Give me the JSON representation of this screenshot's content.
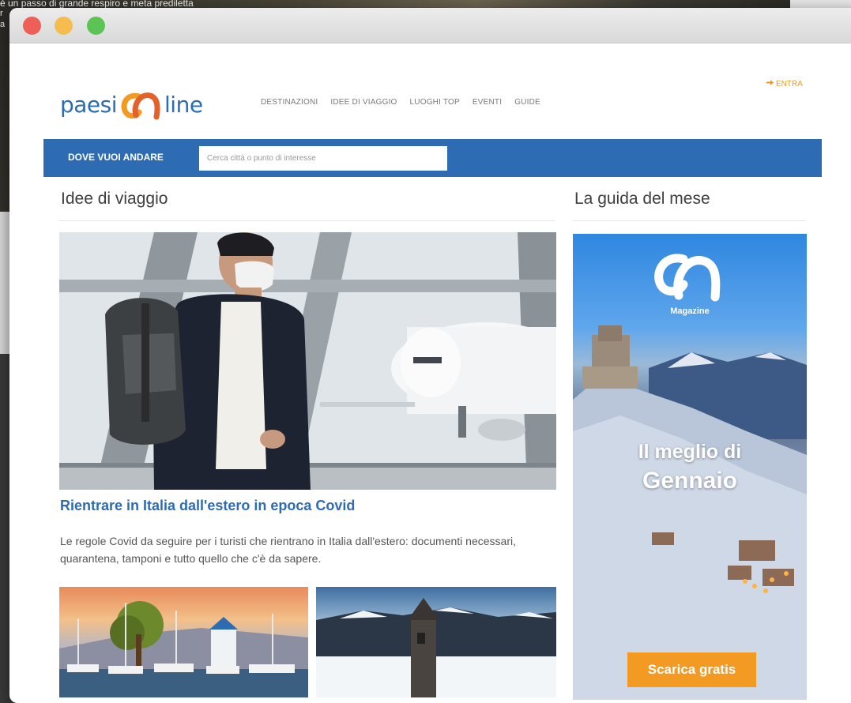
{
  "background": {
    "caption": "è un passo di grande respiro e meta prediletta",
    "fragments": [
      "r",
      "a"
    ]
  },
  "site": {
    "logo_left": "paesi",
    "logo_right": "line",
    "brand_colors": {
      "blue": "#2d6bb3",
      "orange": "#f39a22"
    }
  },
  "nav": {
    "items": [
      "DESTINAZIONI",
      "IDEE DI VIAGGIO",
      "LUOGHI TOP",
      "EVENTI",
      "GUIDE"
    ],
    "login": "ENTRA"
  },
  "search": {
    "label": "DOVE VUOI ANDARE",
    "placeholder": "Cerca città o punto di interesse"
  },
  "main": {
    "section_title": "Idee di viaggio",
    "featured": {
      "title": "Rientrare in Italia dall'estero in epoca Covid",
      "description": "Le regole Covid da seguire per i turisti che rientrano in Italia dall'estero: documenti necessari, quarantena, tamponi e tutto quello che c'è da sapere."
    }
  },
  "sidebar": {
    "section_title": "La guida del mese",
    "ad": {
      "brand": "Magazine",
      "headline_1": "Il meglio di",
      "headline_2": "Gennaio",
      "cta": "Scarica gratis"
    }
  }
}
